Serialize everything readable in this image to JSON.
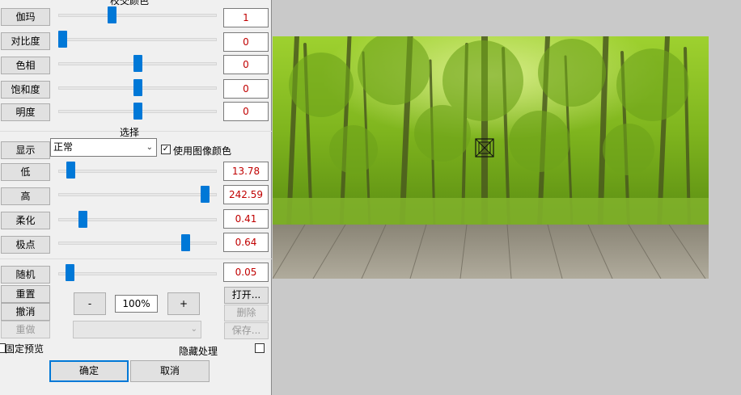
{
  "top_section": {
    "title": "校交颜色",
    "rows": [
      {
        "label": "伽玛",
        "value": "1",
        "level": 0.3
      },
      {
        "label": "对比度",
        "value": "0",
        "level": 0.0
      },
      {
        "label": "色相",
        "value": "0",
        "level": 0.5
      },
      {
        "label": "饱和度",
        "value": "0",
        "level": 0.5
      },
      {
        "label": "明度",
        "value": "0",
        "level": 0.5
      }
    ]
  },
  "select_section": {
    "title": "选择",
    "display_label": "显示",
    "display_value": "正常",
    "use_image_color_label": "使用图像颜色",
    "use_image_color_checked": true,
    "rows": [
      {
        "label": "低",
        "value": "13.78",
        "level": 0.05
      },
      {
        "label": "高",
        "value": "242.59",
        "level": 0.95
      },
      {
        "label": "柔化",
        "value": "0.41",
        "level": 0.15
      },
      {
        "label": "极点",
        "value": "0.64",
        "level": 0.8
      }
    ]
  },
  "random": {
    "label": "随机",
    "value": "0.05",
    "level": 0.0
  },
  "actions": {
    "reset": "重置",
    "undo": "撤消",
    "redo": "重做",
    "minus": "-",
    "zoom": "100%",
    "plus": "+",
    "open": "打开...",
    "delete": "删除",
    "save": "保存..."
  },
  "fixed_preview_label": "固定预览",
  "hide_processing_label": "隐藏处理",
  "ok": "确定",
  "cancel": "取消",
  "colors": {
    "accent": "#0078d7",
    "value_text": "#c00000"
  }
}
